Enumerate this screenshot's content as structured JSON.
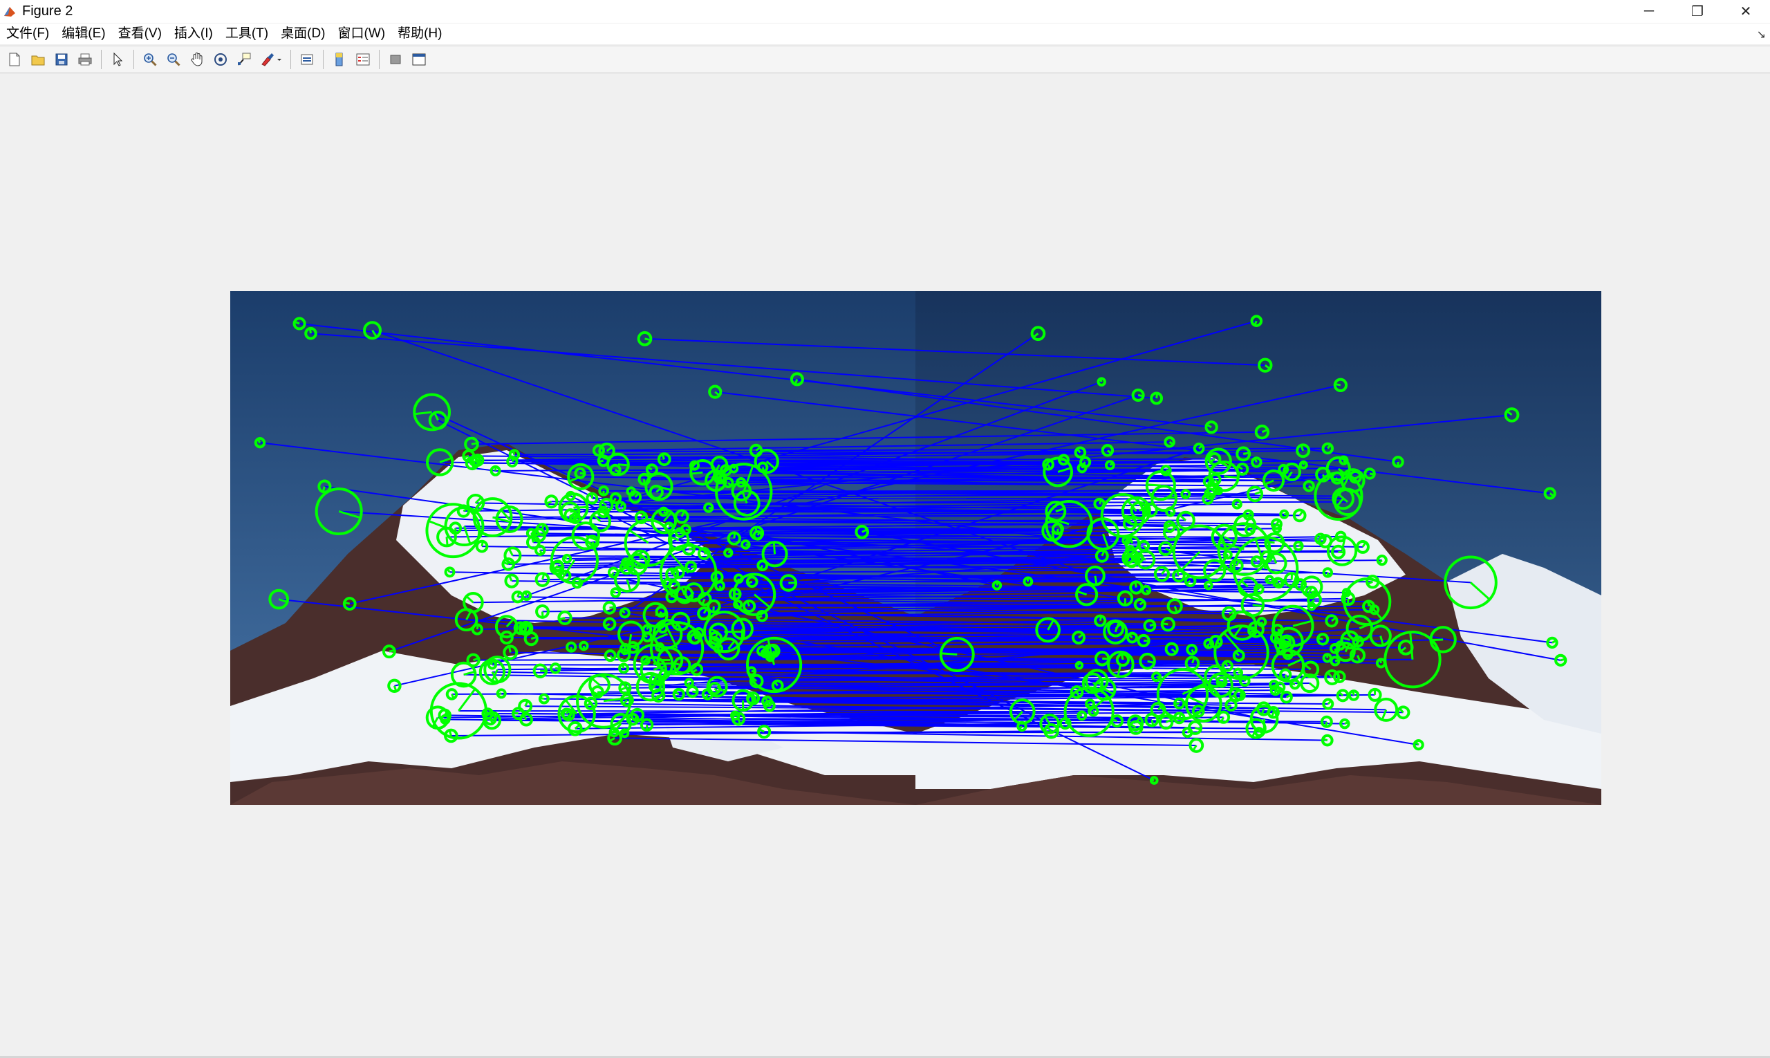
{
  "window": {
    "title": "Figure 2",
    "minimize_glyph": "─",
    "restore_glyph": "❐",
    "close_glyph": "✕"
  },
  "menu": [
    {
      "label": "文件(F)"
    },
    {
      "label": "编辑(E)"
    },
    {
      "label": "查看(V)"
    },
    {
      "label": "插入(I)"
    },
    {
      "label": "工具(T)"
    },
    {
      "label": "桌面(D)"
    },
    {
      "label": "窗口(W)"
    },
    {
      "label": "帮助(H)"
    }
  ],
  "menu_overflow_glyph": "↘",
  "toolbar": [
    {
      "icon": "new-figure-icon"
    },
    {
      "icon": "open-file-icon"
    },
    {
      "icon": "save-icon"
    },
    {
      "icon": "print-icon"
    },
    {
      "icon": "separator"
    },
    {
      "icon": "edit-plot-arrow-icon"
    },
    {
      "icon": "separator"
    },
    {
      "icon": "zoom-in-icon"
    },
    {
      "icon": "zoom-out-icon"
    },
    {
      "icon": "pan-hand-icon"
    },
    {
      "icon": "rotate-3d-icon"
    },
    {
      "icon": "data-cursor-icon"
    },
    {
      "icon": "brush-icon"
    },
    {
      "icon": "separator"
    },
    {
      "icon": "link-plot-icon"
    },
    {
      "icon": "separator"
    },
    {
      "icon": "colorbar-icon"
    },
    {
      "icon": "legend-icon"
    },
    {
      "icon": "separator"
    },
    {
      "icon": "hide-plot-tools-icon"
    },
    {
      "icon": "show-plot-tools-icon"
    }
  ],
  "colors": {
    "match_line": "#0000ff",
    "keypoint": "#00ff00",
    "sky_top": "#1a3a66",
    "sky_bottom": "#3a6aa0",
    "snow": "#f2f4f8",
    "rock": "#5a3430"
  },
  "image": {
    "description_label": "",
    "panels": 2
  }
}
